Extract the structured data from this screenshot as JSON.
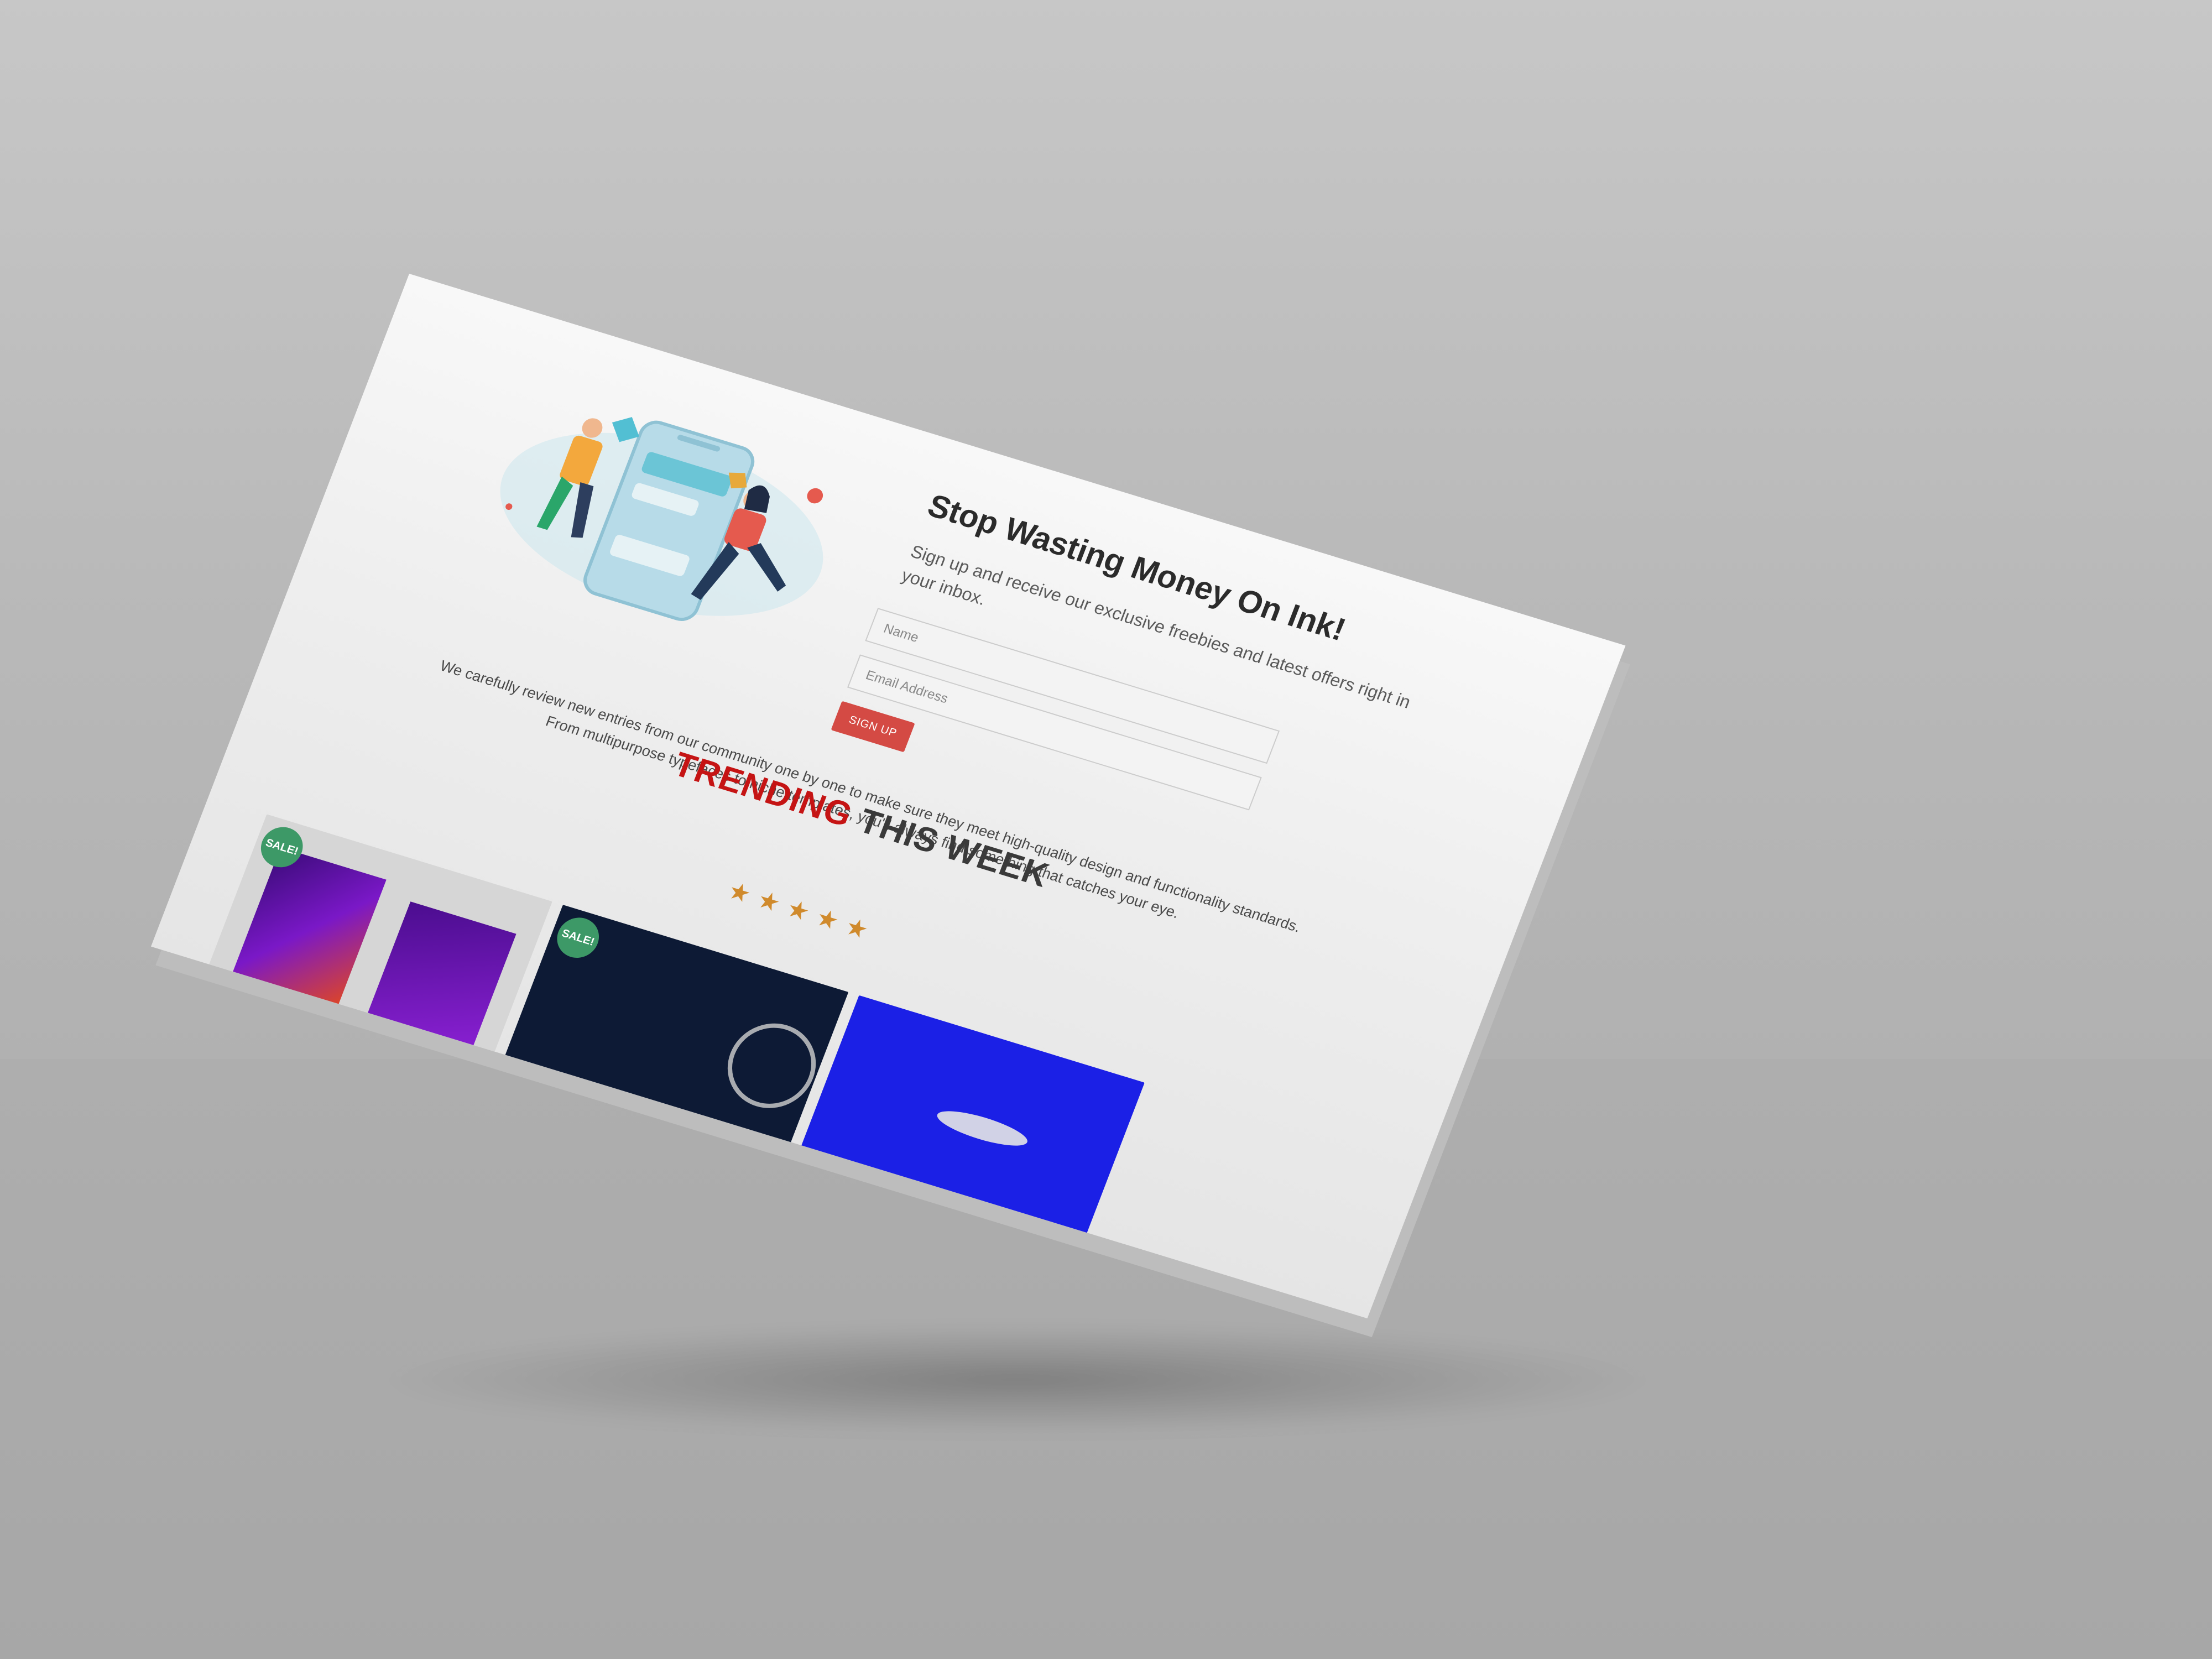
{
  "newsletter": {
    "title": "Stop Wasting Money On Ink!",
    "subtitle": "Sign up and receive our exclusive freebies and latest offers right in your inbox.",
    "name_placeholder": "Name",
    "email_placeholder": "Email Address",
    "signup_label": "SIGN UP"
  },
  "trending": {
    "accent": "TRENDING",
    "rest": " THIS WEEK",
    "description_line1": "We carefully review new entries from our community one by one to make sure they meet high-quality design and functionality standards.",
    "description_line2": "From multipurpose typefaces to niche templates, you'll always find something that catches your eye.",
    "stars": "★★★★★",
    "rating": 5
  },
  "products": [
    {
      "badge": "SALE!"
    },
    {
      "badge": "SALE!"
    },
    {
      "badge": ""
    }
  ],
  "colors": {
    "accent_red": "#c51414",
    "signup_red": "#d44a44",
    "star_orange": "#d08a2c",
    "sale_green": "#3d9967"
  },
  "icons": {
    "illustration": "people-assembling-phone-illustration",
    "rating": "star-icon"
  }
}
